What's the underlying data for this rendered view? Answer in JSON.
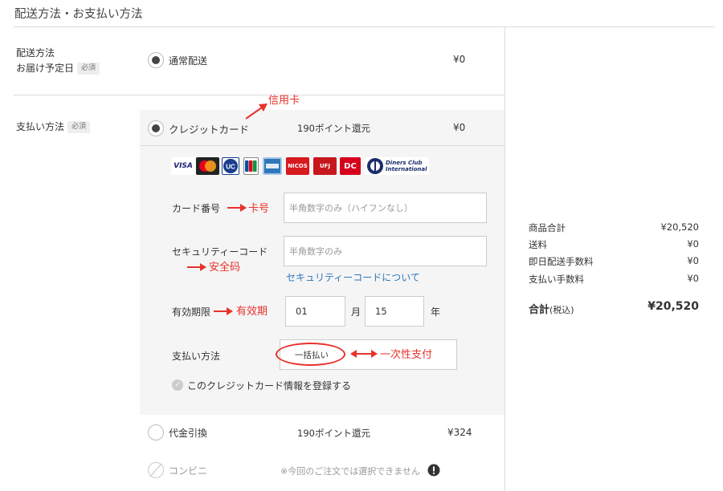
{
  "page_title": "配送方法・お支払い方法",
  "delivery": {
    "label_line1": "配送方法",
    "label_line2": "お届け予定日",
    "required_badge": "必須",
    "option_label": "通常配送",
    "option_price": "¥0"
  },
  "payment": {
    "label": "支払い方法",
    "required_badge": "必須",
    "credit": {
      "label": "クレジットカード",
      "points": "190ポイント還元",
      "price": "¥0",
      "brands": [
        "VISA",
        "MasterCard",
        "UC",
        "JCB",
        "AMERICAN EXPRESS",
        "NICOS",
        "UFJ",
        "DC",
        "Diners Club International"
      ],
      "card_number_label": "カード番号",
      "card_number_placeholder": "半角数字のみ（ハイフンなし）",
      "security_code_label": "セキュリティーコード",
      "security_code_placeholder": "半角数字のみ",
      "security_code_link": "セキュリティーコードについて",
      "expiry_label": "有効期限",
      "expiry_month_value": "01",
      "expiry_month_unit": "月",
      "expiry_year_value": "15",
      "expiry_year_unit": "年",
      "installment_label": "支払い方法",
      "installment_value": "一括払い",
      "save_card_label": "このクレジットカード情報を登録する"
    },
    "cod": {
      "label": "代金引換",
      "points": "190ポイント還元",
      "price": "¥324"
    },
    "convenience": {
      "label": "コンビニ",
      "notice": "※今回のご注文では選択できません"
    }
  },
  "annotations": {
    "credit_card": "信用卡",
    "card_number": "卡号",
    "security_code": "安全码",
    "expiry": "有效期",
    "one_time": "一次性支付"
  },
  "summary": {
    "rows": [
      {
        "label": "商品合計",
        "value": "¥20,520"
      },
      {
        "label": "送料",
        "value": "¥0"
      },
      {
        "label": "即日配送手数料",
        "value": "¥0"
      },
      {
        "label": "支払い手数料",
        "value": "¥0"
      }
    ],
    "total_label": "合計",
    "total_tax": "(税込)",
    "total_value": "¥20,520"
  },
  "colors": {
    "annotation_red": "#e8322b",
    "link_blue": "#2b76b9",
    "panel_bg": "#f5f5f5"
  }
}
